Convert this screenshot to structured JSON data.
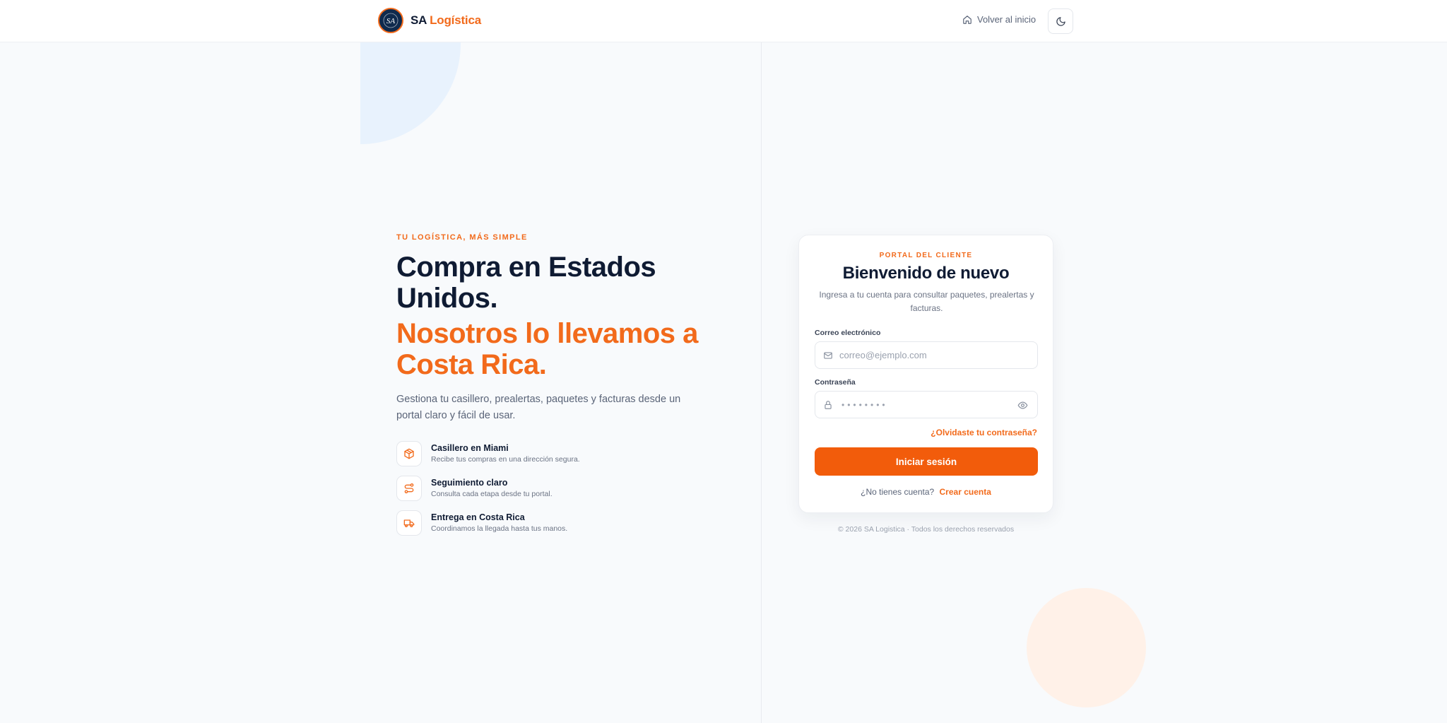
{
  "header": {
    "brand_sa": "SA",
    "brand_logistica": "Logística",
    "logo_text": "SA",
    "home_link": "Volver al inicio"
  },
  "hero": {
    "eyebrow": "TU LOGÍSTICA, MÁS SIMPLE",
    "headline": "Compra en Estados Unidos.",
    "headline_accent": "Nosotros lo llevamos a Costa Rica.",
    "lead": "Gestiona tu casillero, prealertas, paquetes y facturas desde un portal claro y fácil de usar.",
    "features": [
      {
        "icon": "package-icon",
        "title": "Casillero en Miami",
        "desc": "Recibe tus compras en una dirección segura."
      },
      {
        "icon": "route-icon",
        "title": "Seguimiento claro",
        "desc": "Consulta cada etapa desde tu portal."
      },
      {
        "icon": "truck-icon",
        "title": "Entrega en Costa Rica",
        "desc": "Coordinamos la llegada hasta tus manos."
      }
    ]
  },
  "login": {
    "eyebrow": "PORTAL DEL CLIENTE",
    "title": "Bienvenido de nuevo",
    "subtitle": "Ingresa a tu cuenta para consultar paquetes, prealertas y facturas.",
    "email_label": "Correo electrónico",
    "email_placeholder": "correo@ejemplo.com",
    "password_label": "Contraseña",
    "password_value": "••••••••",
    "forgot": "¿Olvidaste tu contraseña?",
    "submit": "Iniciar sesión",
    "no_account": "¿No tienes cuenta?",
    "create_account": "Crear cuenta"
  },
  "footer": {
    "copyright": "© 2026 SA Logistica · Todos los derechos reservados"
  },
  "colors": {
    "accent": "#f25c0b",
    "navy": "#0f1b33"
  }
}
